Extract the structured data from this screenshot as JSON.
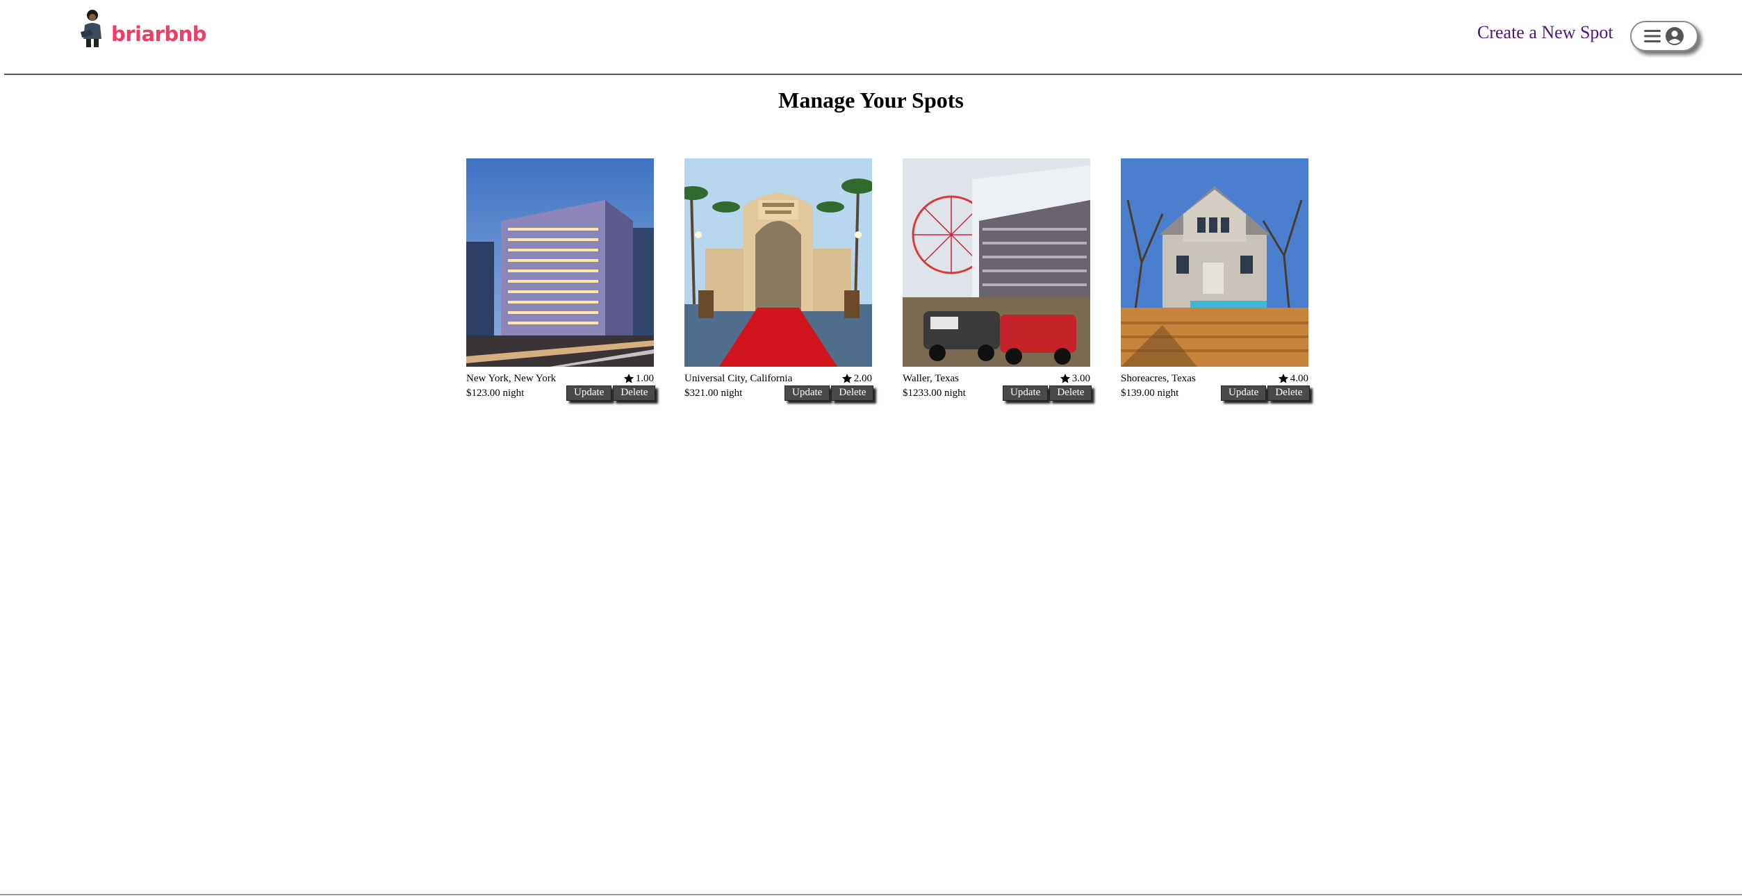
{
  "header": {
    "logo_text": "briarbnb",
    "create_spot_label": "Create a New Spot",
    "brand_color": "#f43b64",
    "link_color": "#4b1a7a"
  },
  "main": {
    "title": "Manage Your Spots",
    "spots": [
      {
        "location": "New York, New York",
        "rating": "1.00",
        "price": "$123.00 night",
        "image": "city-hotel-building"
      },
      {
        "location": "Universal City, California",
        "rating": "2.00",
        "price": "$321.00 night",
        "image": "theme-park-arch-gate"
      },
      {
        "location": "Waller, Texas",
        "rating": "3.00",
        "price": "$1233.00 night",
        "image": "fair-demolition-derby"
      },
      {
        "location": "Shoreacres, Texas",
        "rating": "4.00",
        "price": "$139.00 night",
        "image": "two-story-house"
      }
    ],
    "update_label": "Update",
    "delete_label": "Delete"
  }
}
